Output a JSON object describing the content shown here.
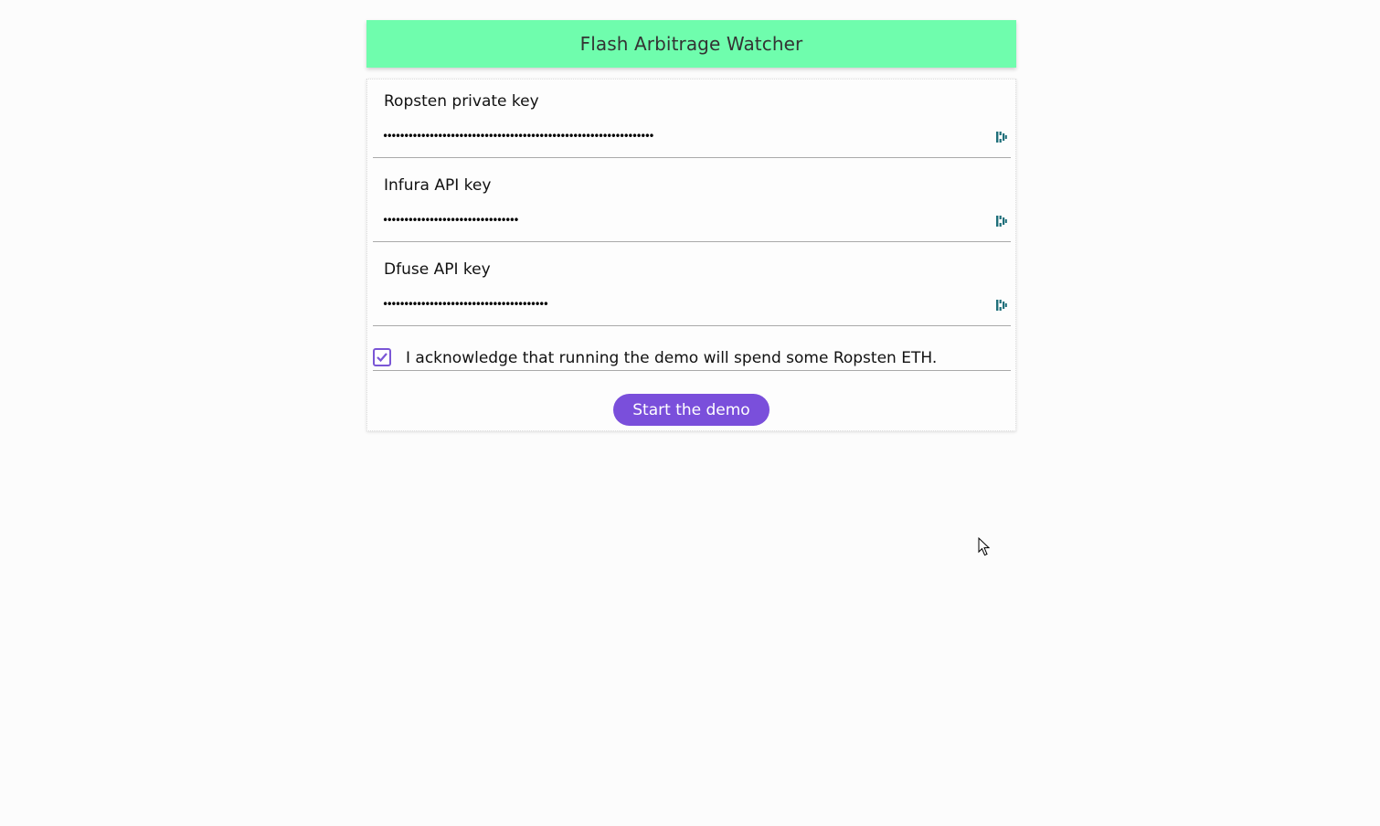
{
  "header": {
    "title": "Flash Arbitrage Watcher",
    "background_color": "#6ffdad"
  },
  "form": {
    "fields": [
      {
        "label": "Ropsten private key",
        "value": "aaaaaaaaaaaaaaaaaaaaaaaaaaaaaaaaaaaaaaaaaaaaaaaaaaaaaaaaaaaaaaaa",
        "reveal_icon": "eye-reveal-icon"
      },
      {
        "label": "Infura API key",
        "value": "aaaaaaaaaaaaaaaaaaaaaaaaaaaaaaaa",
        "reveal_icon": "eye-reveal-icon"
      },
      {
        "label": "Dfuse API key",
        "value": "aaaaaaaaaaaaaaaaaaaaaaaaaaaaaaaaaaaaaaa",
        "reveal_icon": "eye-reveal-icon"
      }
    ],
    "acknowledge": {
      "label": "I acknowledge that running the demo will spend some Ropsten ETH.",
      "checked": true,
      "check_icon": "checkmark-icon"
    },
    "start_button": {
      "label": "Start the demo",
      "color": "#7a4fdb"
    },
    "accent_color": "#7a56d6",
    "icon_color": "#1f6f7a"
  },
  "cursor": {
    "icon": "mouse-pointer-icon"
  }
}
